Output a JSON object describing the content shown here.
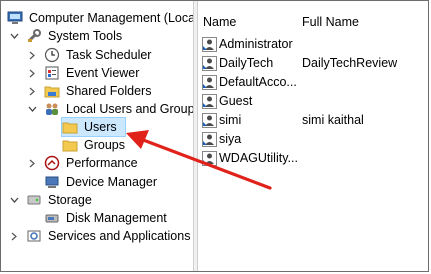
{
  "tree": {
    "root": "Computer Management (Local",
    "system_tools": "System Tools",
    "task_scheduler": "Task Scheduler",
    "event_viewer": "Event Viewer",
    "shared_folders": "Shared Folders",
    "local_users": "Local Users and Groups",
    "users": "Users",
    "groups": "Groups",
    "performance": "Performance",
    "device_manager": "Device Manager",
    "storage": "Storage",
    "disk_management": "Disk Management",
    "services": "Services and Applications"
  },
  "list": {
    "col_name": "Name",
    "col_full": "Full Name",
    "rows": [
      {
        "name": "Administrator",
        "full": ""
      },
      {
        "name": "DailyTech",
        "full": "DailyTechReview"
      },
      {
        "name": "DefaultAcco...",
        "full": ""
      },
      {
        "name": "Guest",
        "full": ""
      },
      {
        "name": "simi",
        "full": "simi kaithal"
      },
      {
        "name": "siya",
        "full": ""
      },
      {
        "name": "WDAGUtility...",
        "full": ""
      }
    ]
  },
  "colors": {
    "selection": "#cce8ff",
    "arrow": "#e0221b",
    "folder": "#f3c94f"
  }
}
